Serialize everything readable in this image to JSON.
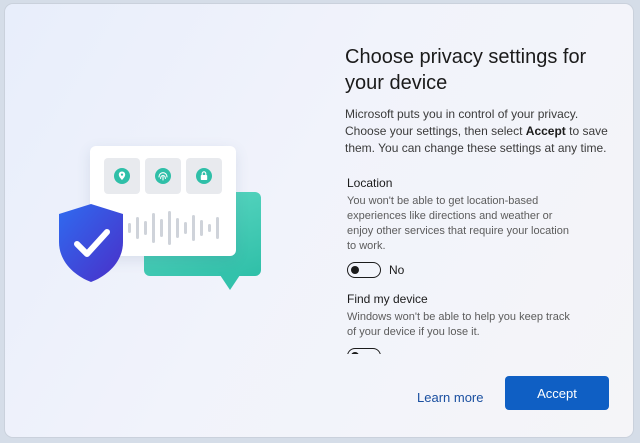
{
  "title": "Choose privacy settings for your device",
  "intro": {
    "before": "Microsoft puts you in control of your privacy. Choose your settings, then select ",
    "bold": "Accept",
    "after": " to save them. You can change these settings at any time."
  },
  "settings": [
    {
      "title": "Location",
      "description": "You won't be able to get location-based experiences like directions and weather or enjoy other services that require your location to work.",
      "state": "No"
    },
    {
      "title": "Find my device",
      "description": "Windows won't be able to help you keep track of your device if you lose it."
    }
  ],
  "buttons": {
    "learn_more": "Learn more",
    "accept": "Accept"
  },
  "colors": {
    "accent": "#0f5fc4",
    "link": "#1a4fa0",
    "teal": "#2fbfa8",
    "shield": "#3b4fd8"
  },
  "illustration": {
    "icons": [
      "location-pin-icon",
      "fingerprint-icon",
      "lock-icon",
      "checkmark-shield-icon"
    ]
  }
}
